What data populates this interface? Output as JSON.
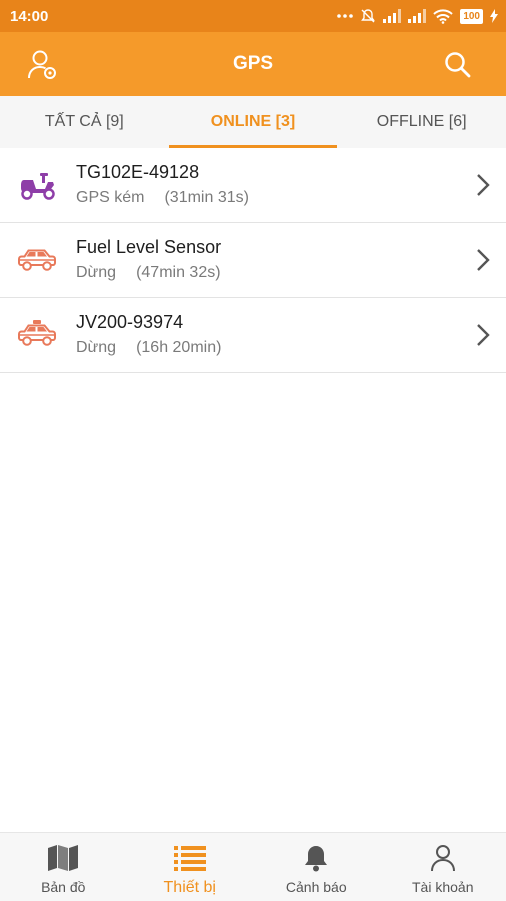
{
  "status_bar": {
    "time": "14:00",
    "battery": "100"
  },
  "app_bar": {
    "title": "GPS"
  },
  "tabs": [
    {
      "label": "TẤT CẢ [9]",
      "active": false
    },
    {
      "label": "ONLINE [3]",
      "active": true
    },
    {
      "label": "OFFLINE [6]",
      "active": false
    }
  ],
  "devices": [
    {
      "name": "TG102E-49128",
      "status": "GPS kém",
      "duration": "(31min 31s)",
      "icon": "scooter-icon",
      "icon_color": "#8e3ea8"
    },
    {
      "name": "Fuel Level Sensor",
      "status": "Dừng",
      "duration": "(47min 32s)",
      "icon": "car-icon",
      "icon_color": "#e8795a"
    },
    {
      "name": "JV200-93974",
      "status": "Dừng",
      "duration": "(16h 20min)",
      "icon": "taxi-icon",
      "icon_color": "#e8795a"
    }
  ],
  "bottom_nav": [
    {
      "label": "Bản đồ",
      "icon": "map-icon",
      "active": false
    },
    {
      "label": "Thiết bị",
      "icon": "list-icon",
      "active": true
    },
    {
      "label": "Cảnh báo",
      "icon": "bell-icon",
      "active": false
    },
    {
      "label": "Tài khoản",
      "icon": "person-icon",
      "active": false
    }
  ],
  "colors": {
    "accent": "#f59a2a",
    "status_bar": "#e8841a",
    "active_text": "#f0911f"
  }
}
